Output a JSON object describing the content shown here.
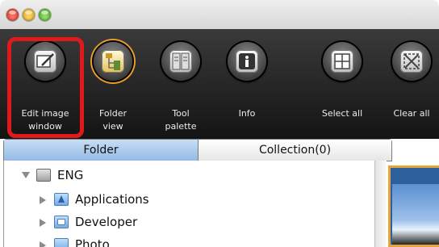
{
  "toolbar": {
    "items": [
      {
        "label_line1": "Edit image",
        "label_line2": "window",
        "icon": "edit-image-window-icon"
      },
      {
        "label_line1": "Folder",
        "label_line2": "view",
        "icon": "folder-view-icon"
      },
      {
        "label_line1": "Tool",
        "label_line2": "palette",
        "icon": "tool-palette-icon"
      },
      {
        "label_line1": "Info",
        "label_line2": "",
        "icon": "info-icon"
      },
      {
        "label_line1": "Select all",
        "label_line2": "",
        "icon": "select-all-icon"
      },
      {
        "label_line1": "Clear all",
        "label_line2": "",
        "icon": "clear-all-icon"
      }
    ]
  },
  "tabs": {
    "folder_label": "Folder",
    "collection_label": "Collection(0)"
  },
  "tree": {
    "items": [
      {
        "label": "ENG",
        "icon": "disk-icon",
        "expanded": true
      },
      {
        "label": "Applications",
        "icon": "applications-folder-icon",
        "expanded": false
      },
      {
        "label": "Developer",
        "icon": "developer-folder-icon",
        "expanded": false
      },
      {
        "label": "Photo",
        "icon": "folder-icon",
        "expanded": false
      }
    ]
  },
  "colors": {
    "highlight": "#e01a1a",
    "active_tab": "#93bbe6",
    "toolbar_bg": "#1e1e1e"
  }
}
